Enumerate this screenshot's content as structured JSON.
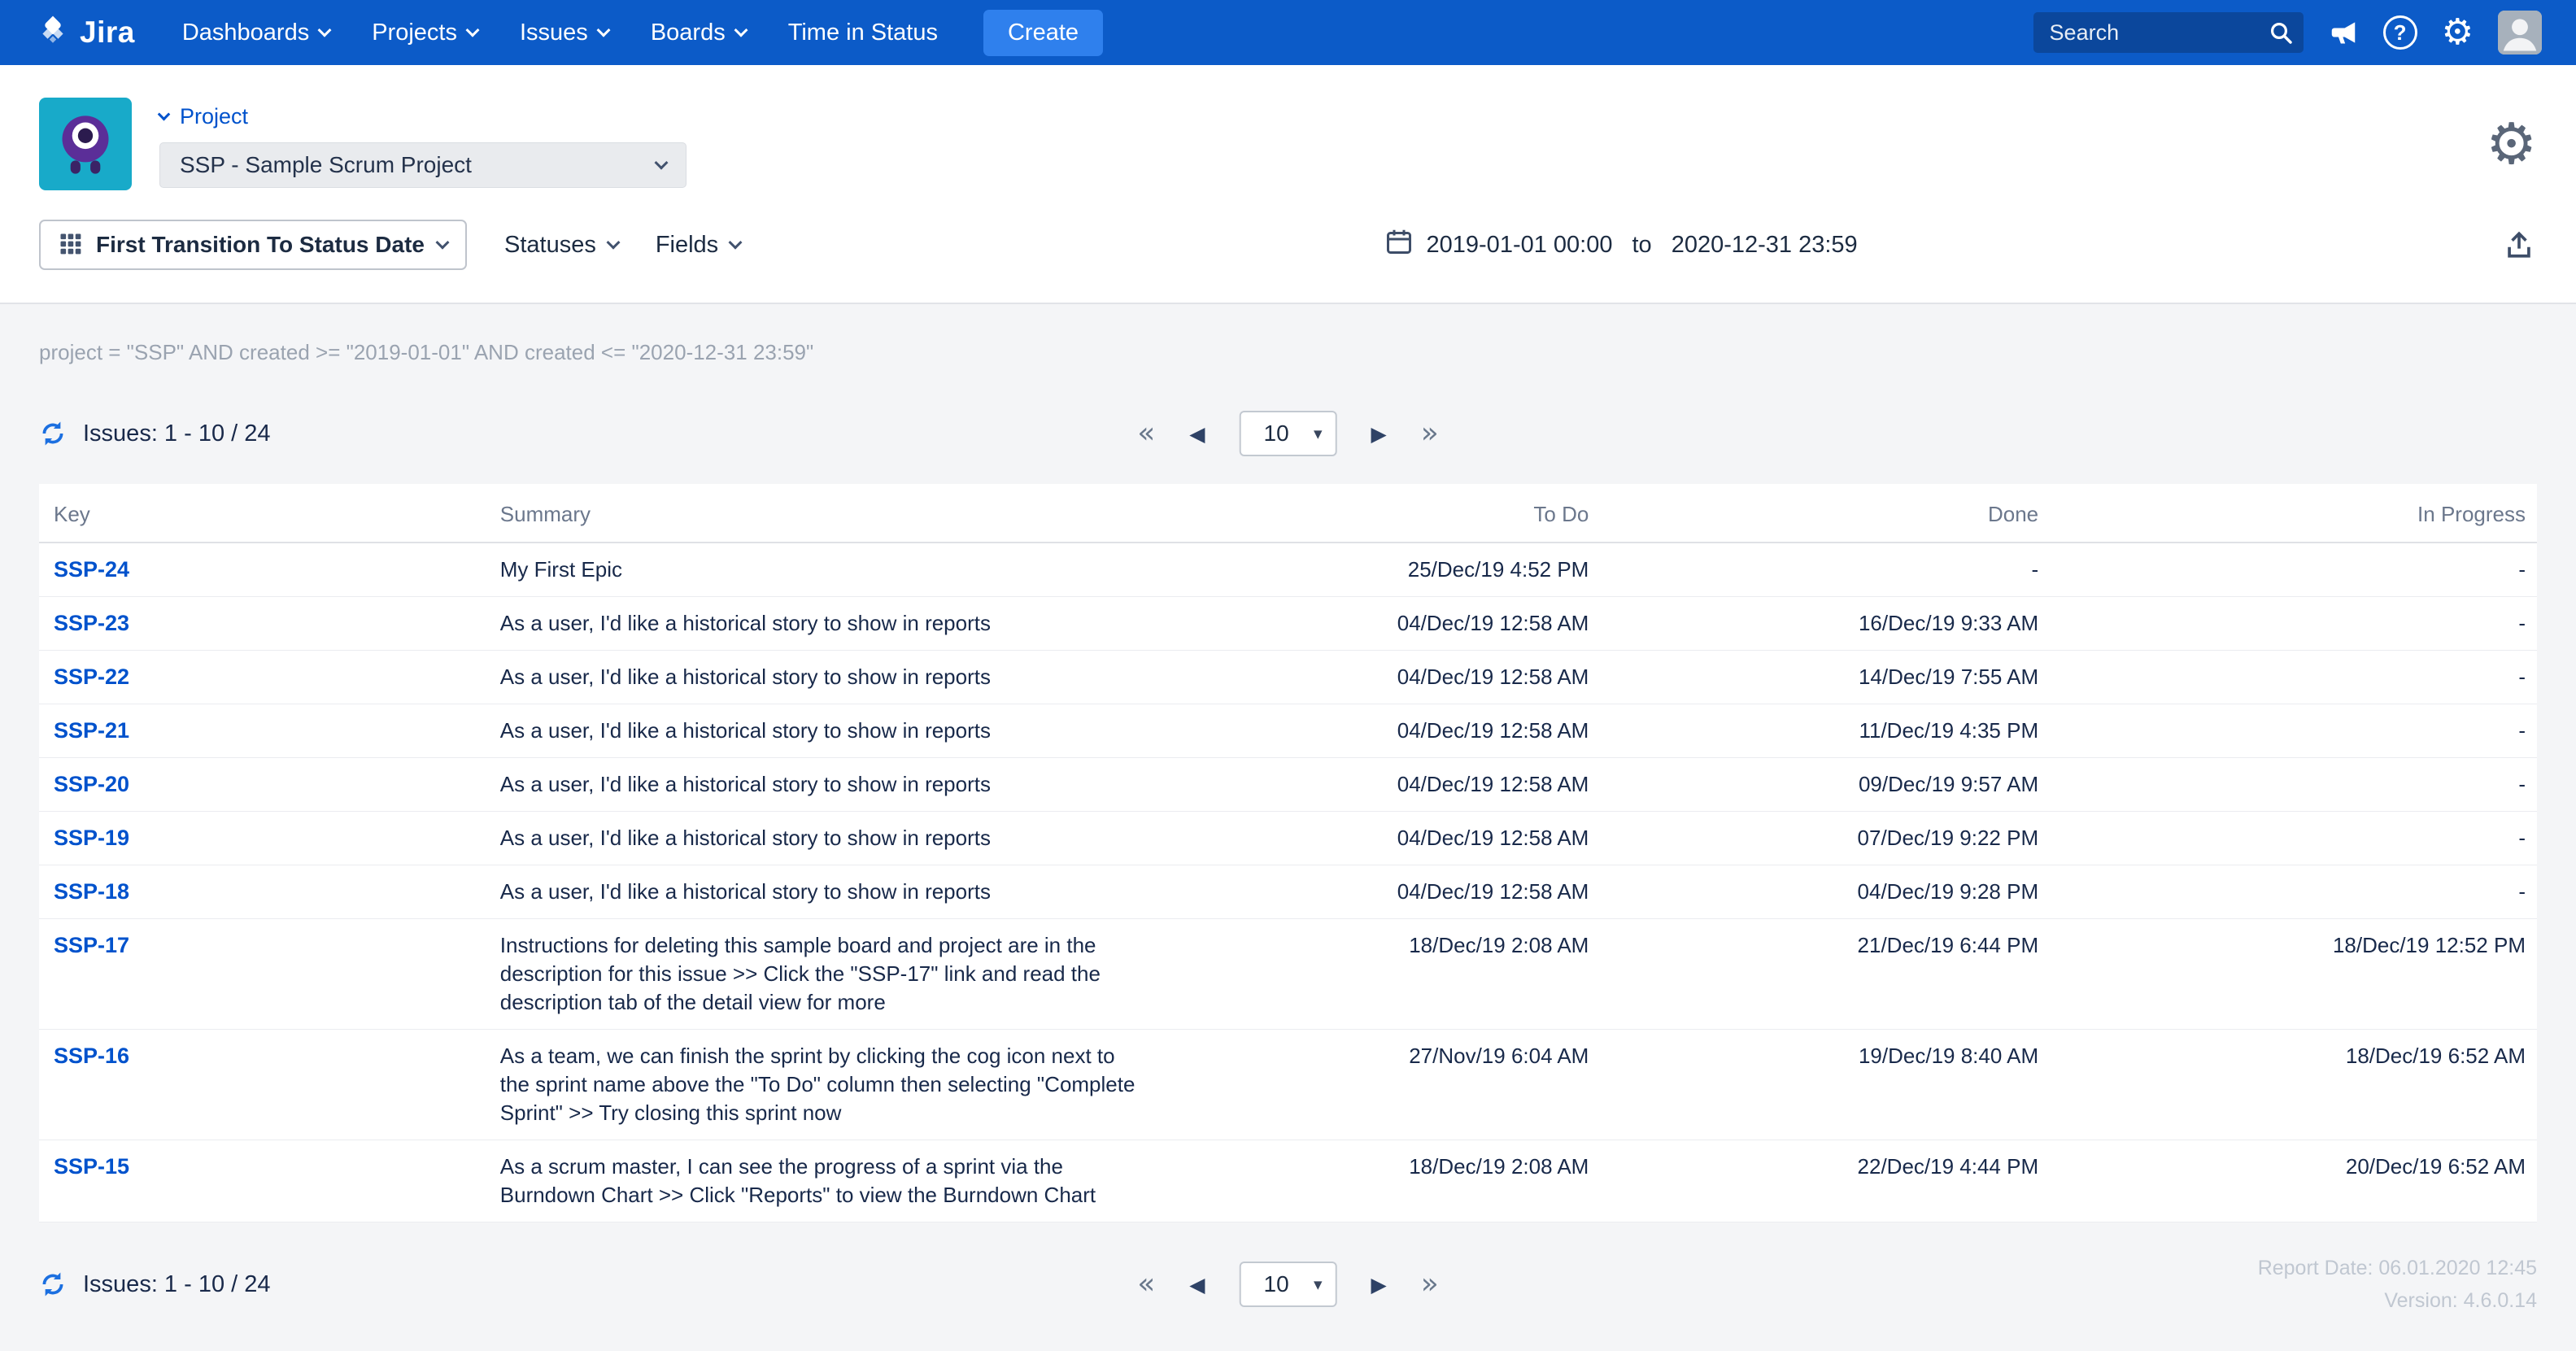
{
  "colors": {
    "navbar_blue": "#0C5BC8",
    "create_button_blue": "#2F80ED",
    "link_blue": "#0052CC",
    "page_background": "#F4F5F7",
    "muted_gray": "#9AA3B0"
  },
  "navbar": {
    "brand": "Jira",
    "items": [
      {
        "label": "Dashboards"
      },
      {
        "label": "Projects"
      },
      {
        "label": "Issues"
      },
      {
        "label": "Boards"
      },
      {
        "label": "Time in Status"
      }
    ],
    "create_label": "Create",
    "search_placeholder": "Search"
  },
  "header": {
    "project_label": "Project",
    "project_select_value": "SSP - Sample Scrum Project"
  },
  "toolbar": {
    "report_type": "First Transition To Status Date",
    "statuses_label": "Statuses",
    "fields_label": "Fields",
    "date_from": "2019-01-01 00:00",
    "date_to_label": "to",
    "date_to": "2020-12-31 23:59"
  },
  "jql": "project = \"SSP\" AND created >= \"2019-01-01\" AND created <= \"2020-12-31 23:59\"",
  "issues_summary": "Issues: 1 - 10 / 24",
  "pagination": {
    "page_size": "10"
  },
  "table": {
    "columns": [
      "Key",
      "Summary",
      "To Do",
      "Done",
      "In Progress"
    ],
    "rows": [
      {
        "key": "SSP-24",
        "summary": "My First Epic",
        "todo": "25/Dec/19 4:52 PM",
        "done": "-",
        "in_progress": "-"
      },
      {
        "key": "SSP-23",
        "summary": "As a user, I'd like a historical story to show in reports",
        "todo": "04/Dec/19 12:58 AM",
        "done": "16/Dec/19 9:33 AM",
        "in_progress": "-"
      },
      {
        "key": "SSP-22",
        "summary": "As a user, I'd like a historical story to show in reports",
        "todo": "04/Dec/19 12:58 AM",
        "done": "14/Dec/19 7:55 AM",
        "in_progress": "-"
      },
      {
        "key": "SSP-21",
        "summary": "As a user, I'd like a historical story to show in reports",
        "todo": "04/Dec/19 12:58 AM",
        "done": "11/Dec/19 4:35 PM",
        "in_progress": "-"
      },
      {
        "key": "SSP-20",
        "summary": "As a user, I'd like a historical story to show in reports",
        "todo": "04/Dec/19 12:58 AM",
        "done": "09/Dec/19 9:57 AM",
        "in_progress": "-"
      },
      {
        "key": "SSP-19",
        "summary": "As a user, I'd like a historical story to show in reports",
        "todo": "04/Dec/19 12:58 AM",
        "done": "07/Dec/19 9:22 PM",
        "in_progress": "-"
      },
      {
        "key": "SSP-18",
        "summary": "As a user, I'd like a historical story to show in reports",
        "todo": "04/Dec/19 12:58 AM",
        "done": "04/Dec/19 9:28 PM",
        "in_progress": "-"
      },
      {
        "key": "SSP-17",
        "summary": "Instructions for deleting this sample board and project are in the description for this issue >> Click the \"SSP-17\" link and read the description tab of the detail view for more",
        "todo": "18/Dec/19 2:08 AM",
        "done": "21/Dec/19 6:44 PM",
        "in_progress": "18/Dec/19 12:52 PM"
      },
      {
        "key": "SSP-16",
        "summary": "As a team, we can finish the sprint by clicking the cog icon next to the sprint name above the \"To Do\" column then selecting \"Complete Sprint\" >> Try closing this sprint now",
        "todo": "27/Nov/19 6:04 AM",
        "done": "19/Dec/19 8:40 AM",
        "in_progress": "18/Dec/19 6:52 AM"
      },
      {
        "key": "SSP-15",
        "summary": "As a scrum master, I can see the progress of a sprint via the Burndown Chart >> Click \"Reports\" to view the Burndown Chart",
        "todo": "18/Dec/19 2:08 AM",
        "done": "22/Dec/19 4:44 PM",
        "in_progress": "20/Dec/19 6:52 AM"
      }
    ]
  },
  "footer": {
    "issues_summary": "Issues: 1 - 10 / 24",
    "report_date": "Report Date: 06.01.2020 12:45",
    "version": "Version: 4.6.0.14"
  },
  "icons": {
    "help": "?",
    "gear": "⚙",
    "first": "«",
    "prev": "◀",
    "next": "▶",
    "last": "»",
    "caret": "▾"
  }
}
